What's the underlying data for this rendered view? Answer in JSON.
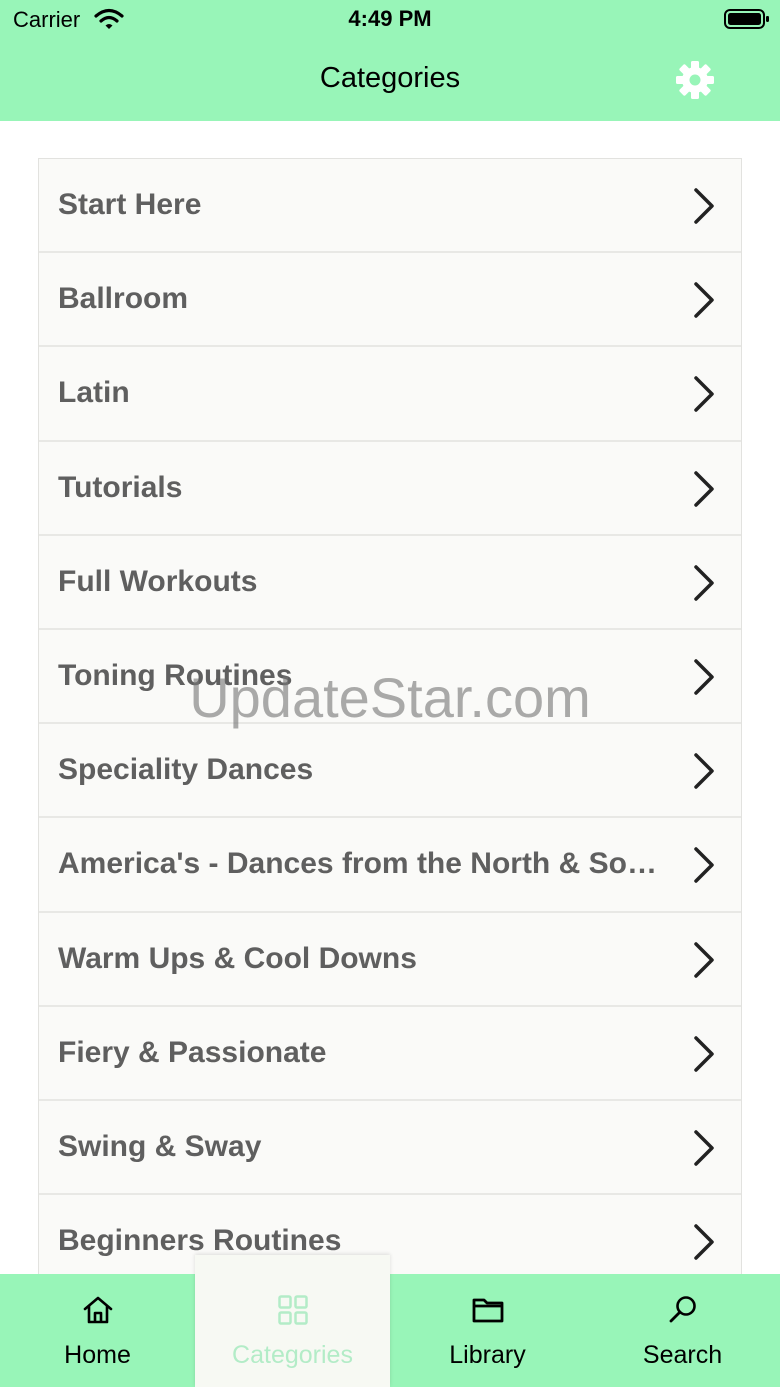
{
  "status_bar": {
    "carrier": "Carrier",
    "time": "4:49 PM",
    "wifi_icon": "wifi-icon",
    "battery_icon": "battery-icon"
  },
  "nav": {
    "title": "Categories",
    "settings_icon": "gear-icon"
  },
  "categories": [
    "Start Here",
    "Ballroom",
    "Latin",
    "Tutorials",
    "Full Workouts",
    "Toning Routines",
    "Speciality Dances",
    "America's - Dances from the North & South",
    "Warm Ups & Cool Downs",
    "Fiery & Passionate",
    "Swing & Sway",
    "Beginners Routines"
  ],
  "watermark": "UpdateStar.com",
  "tabs": [
    {
      "label": "Home",
      "icon": "home-icon",
      "active": false
    },
    {
      "label": "Categories",
      "icon": "grid-icon",
      "active": true
    },
    {
      "label": "Library",
      "icon": "folder-icon",
      "active": false
    },
    {
      "label": "Search",
      "icon": "search-icon",
      "active": false
    }
  ],
  "colors": {
    "bar_green": "#98f5b8",
    "active_tab_label": "#b3ecc7",
    "list_background": "#fafaf8",
    "list_text": "#5f5f5f"
  }
}
